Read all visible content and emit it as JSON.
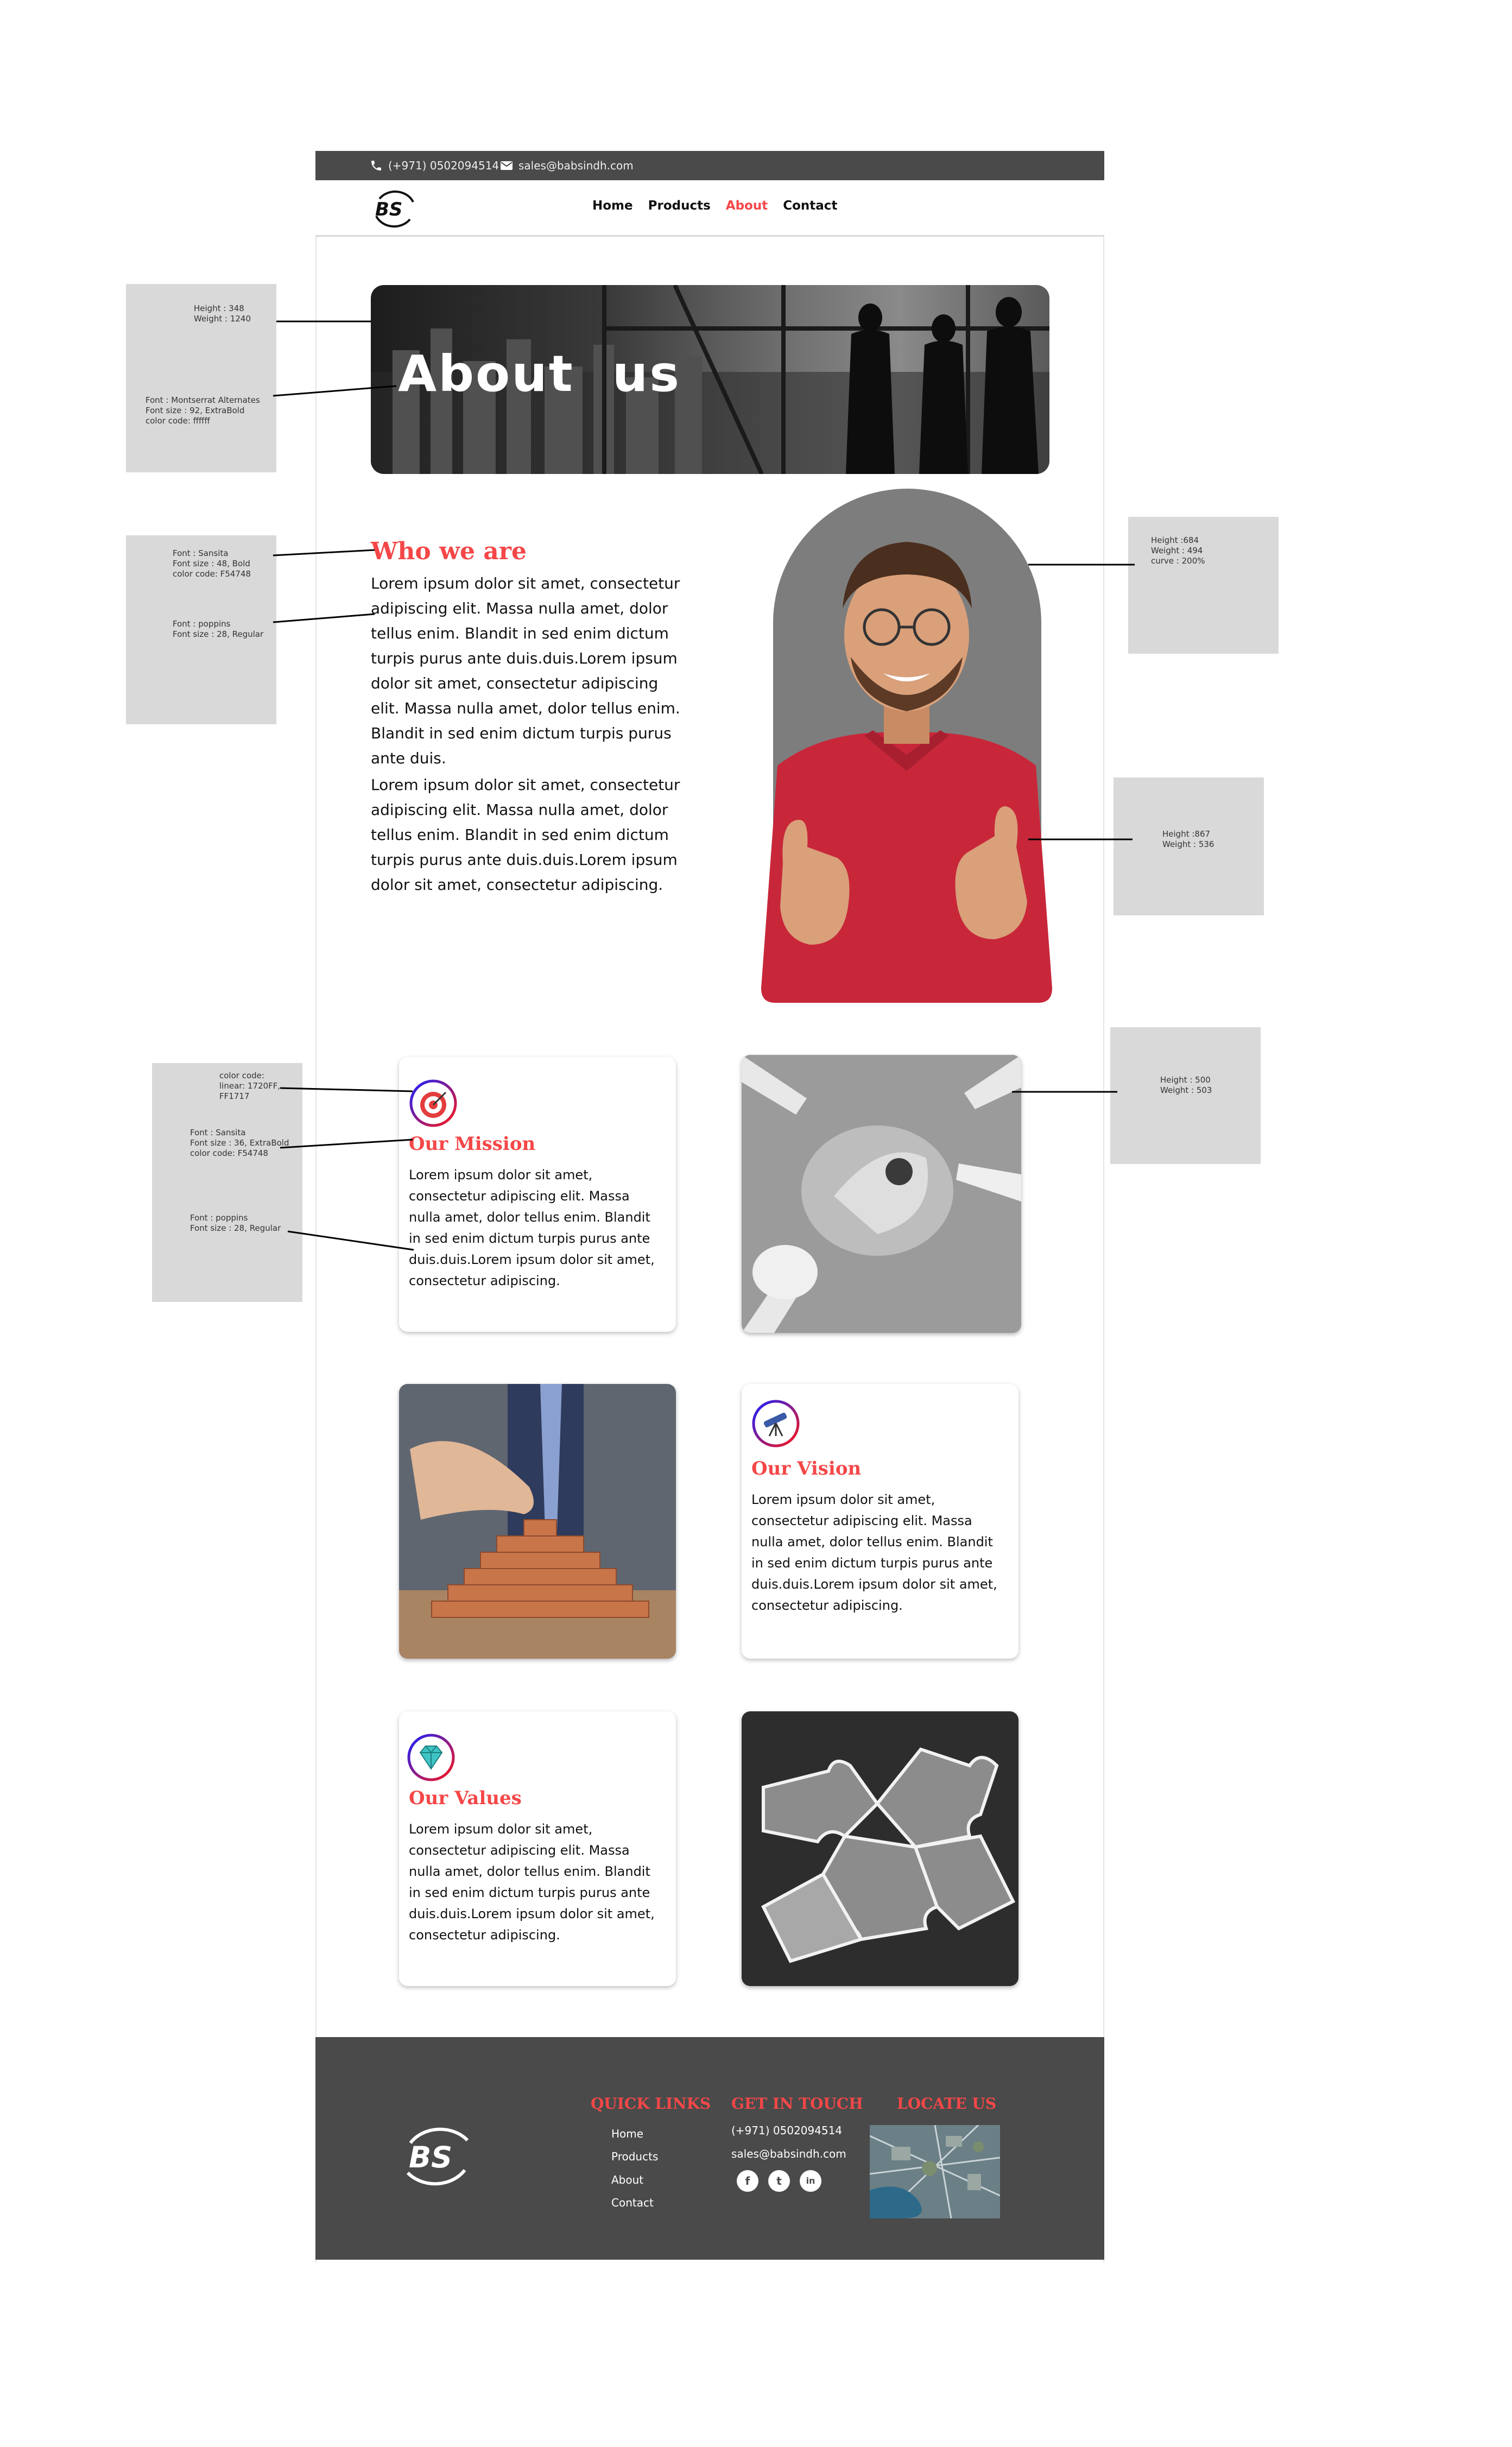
{
  "topbar": {
    "phone": "(+971) 0502094514",
    "email": "sales@babsindh.com"
  },
  "nav": {
    "logo": "BS",
    "links": [
      "Home",
      "Products",
      "About",
      "Contact"
    ],
    "active": "About"
  },
  "hero": {
    "title": "About  us"
  },
  "who": {
    "title": "Who we are",
    "para1": "Lorem ipsum dolor sit amet, consectetur adipiscing elit. Massa nulla amet, dolor tellus enim. Blandit in sed enim dictum turpis purus ante duis.duis.Lorem ipsum dolor sit amet, consectetur adipiscing elit. Massa nulla amet, dolor tellus enim. Blandit in sed enim dictum turpis purus ante duis.",
    "para2": "Lorem ipsum dolor sit amet, consectetur adipiscing elit. Massa nulla amet, dolor tellus enim. Blandit in sed enim dictum turpis purus ante duis.duis.Lorem ipsum dolor sit amet, consectetur adipiscing."
  },
  "cards": {
    "mission": {
      "title": "Our Mission",
      "text": "Lorem ipsum dolor sit amet, consectetur adipiscing elit. Massa nulla amet, dolor tellus enim. Blandit in sed enim dictum turpis purus ante duis.duis.Lorem ipsum dolor sit amet, consectetur adipiscing."
    },
    "vision": {
      "title": "Our Vision",
      "text": "Lorem ipsum dolor sit amet, consectetur adipiscing elit. Massa nulla amet, dolor tellus enim. Blandit in sed enim dictum turpis purus ante duis.duis.Lorem ipsum dolor sit amet, consectetur adipiscing."
    },
    "values": {
      "title": "Our Values",
      "text": "Lorem ipsum dolor sit amet, consectetur adipiscing elit. Massa nulla amet, dolor tellus enim. Blandit in sed enim dictum turpis purus ante duis.duis.Lorem ipsum dolor sit amet, consectetur adipiscing."
    }
  },
  "footer": {
    "logo": "BS",
    "quick_links_title": "QUICK LINKS",
    "quick_links": [
      "Home",
      "Products",
      "About",
      "Contact"
    ],
    "touch_title": "GET IN TOUCH",
    "phone": "(+971) 0502094514",
    "email": "sales@babsindh.com",
    "social": [
      "f",
      "t",
      "in"
    ],
    "locate_title": "LOCATE US"
  },
  "annotations": {
    "hero_box": [
      "Height : 348",
      "Weight : 1240"
    ],
    "hero_font": [
      "Font : Montserrat Alternates",
      "Font size : 92, ExtraBold",
      "color code: ffffff"
    ],
    "who_font": [
      "Font : Sansita",
      "Font size : 48, Bold",
      "color code: F54748"
    ],
    "para_font": [
      "Font : poppins",
      "Font size : 28, Regular"
    ],
    "arch_box": [
      "Height :684",
      "Weight : 494",
      "curve : 200%"
    ],
    "person_box": [
      "Height :867",
      "Weight : 536"
    ],
    "icon_color": [
      "color code:",
      "linear: 1720FF,",
      "FF1717"
    ],
    "mission_font": [
      "Font : Sansita",
      "Font size : 36, ExtraBold",
      "color code: F54748"
    ],
    "mission_text_font": [
      "Font : poppins",
      "Font size : 28, Regular"
    ],
    "image_box": [
      "Height : 500",
      "Weight : 503"
    ]
  },
  "colors": {
    "accent": "#F54748",
    "dark": "#4a4a4a",
    "icon_gradient_start": "#1720FF",
    "icon_gradient_end": "#FF1717"
  }
}
